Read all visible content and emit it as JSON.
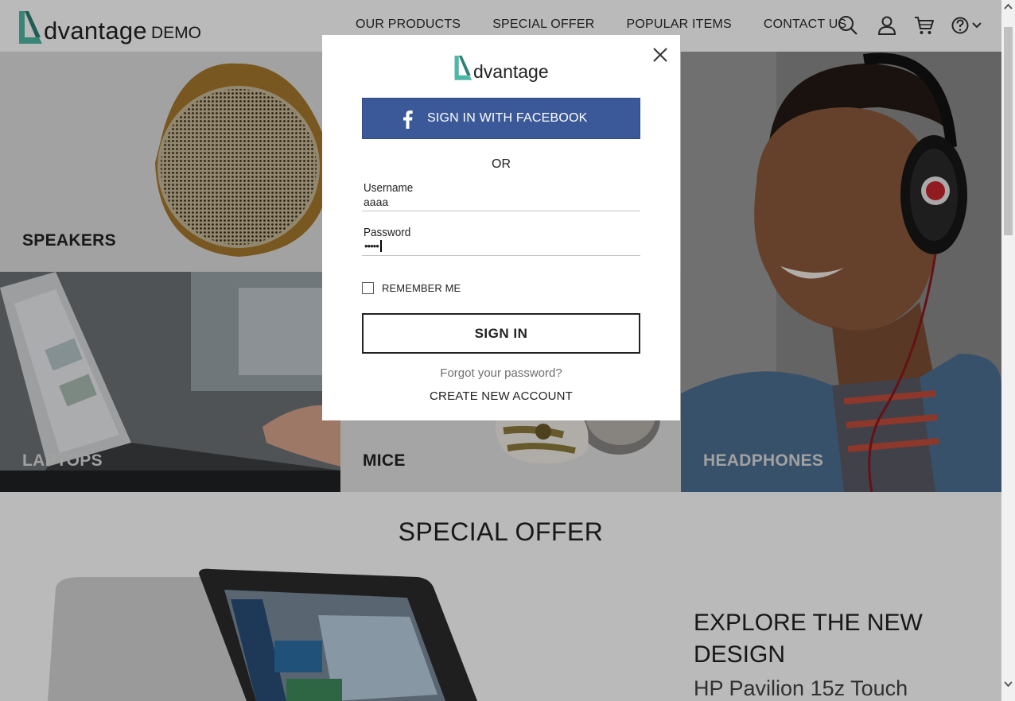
{
  "header": {
    "logo_word": "dvantage",
    "logo_suffix": "DEMO",
    "nav": [
      "OUR PRODUCTS",
      "SPECIAL OFFER",
      "POPULAR ITEMS",
      "CONTACT US"
    ],
    "icons": [
      "search-icon",
      "user-icon",
      "cart-icon",
      "help-icon",
      "chevron-down-icon"
    ]
  },
  "categories": {
    "speakers": "SPEAKERS",
    "laptops": "LAPTOPS",
    "mice": "MICE",
    "headphones": "HEADPHONES"
  },
  "special_offer": {
    "title": "SPECIAL OFFER",
    "headline": "EXPLORE THE NEW DESIGN",
    "product": "HP Pavilion 15z Touch"
  },
  "login_modal": {
    "logo_word": "dvantage",
    "facebook_label": "SIGN IN WITH FACEBOOK",
    "or_label": "OR",
    "username_label": "Username",
    "username_value": "aaaa",
    "password_label": "Password",
    "password_masked": "•••••",
    "remember_label": "REMEMBER ME",
    "remember_checked": false,
    "signin_label": "SIGN IN",
    "forgot_label": "Forgot your password?",
    "create_label": "CREATE NEW ACCOUNT"
  },
  "colors": {
    "brand_teal": "#4fb7a5",
    "facebook_blue": "#3b5998"
  }
}
